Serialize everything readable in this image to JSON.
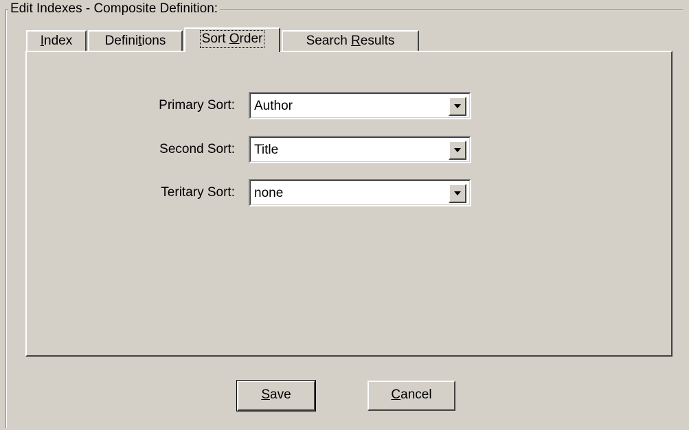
{
  "group": {
    "title": "Edit  Indexes - Composite Definition:"
  },
  "tabs": [
    {
      "pre": "",
      "mn": "I",
      "post": "ndex",
      "active": false
    },
    {
      "pre": "Defini",
      "mn": "t",
      "post": "ions",
      "active": false
    },
    {
      "pre": "Sort ",
      "mn": "O",
      "post": "rder",
      "active": true
    },
    {
      "pre": "Search ",
      "mn": "R",
      "post": "esults",
      "active": false
    }
  ],
  "sort_order": {
    "primary": {
      "label": "Primary Sort:",
      "value": "Author"
    },
    "second": {
      "label": "Second Sort:",
      "value": "Title"
    },
    "tertiary": {
      "label": "Teritary Sort:",
      "value": "none"
    }
  },
  "buttons": {
    "save": {
      "mn": "S",
      "rest": "ave"
    },
    "cancel": {
      "mn": "C",
      "rest": "ancel"
    }
  }
}
